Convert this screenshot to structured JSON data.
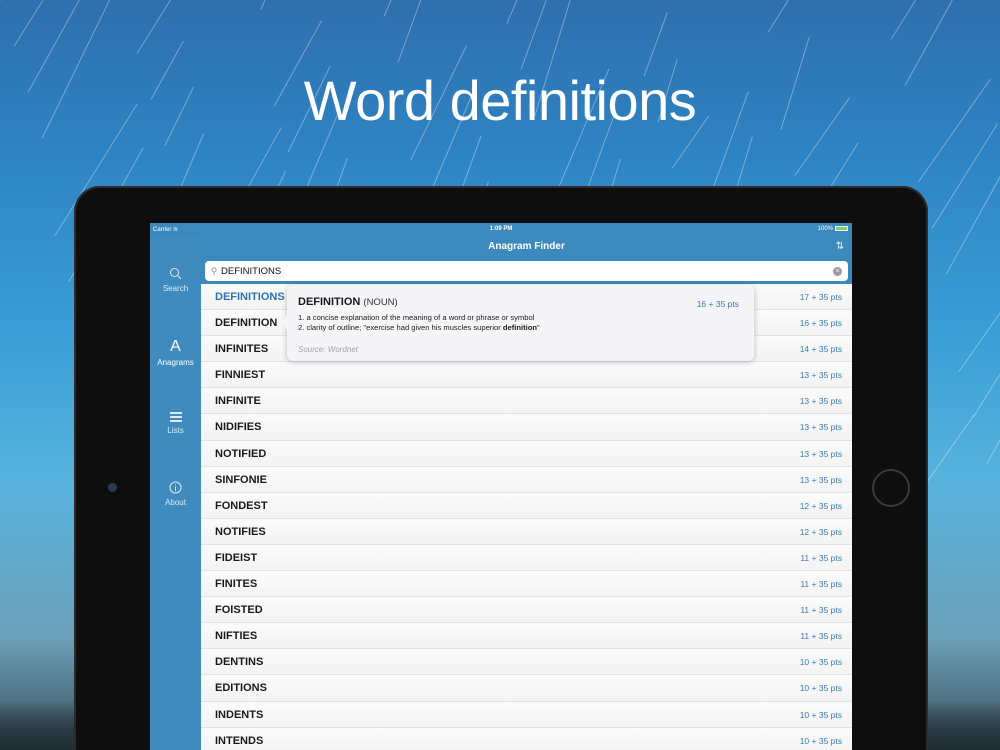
{
  "headline": "Word definitions",
  "status_bar": {
    "carrier": "Carrier",
    "time": "1:09 PM",
    "battery": "100%"
  },
  "nav": {
    "title": "Anagram Finder",
    "sort_icon": "sort-icon"
  },
  "search": {
    "value": "DEFINITIONS",
    "icon": "search-icon",
    "clear_icon": "clear-icon"
  },
  "sidebar": {
    "items": [
      {
        "label": "Search",
        "icon": "search-icon"
      },
      {
        "label": "Anagrams",
        "icon": "letter-a-icon"
      },
      {
        "label": "Lists",
        "icon": "list-icon"
      },
      {
        "label": "About",
        "icon": "info-icon"
      }
    ]
  },
  "results": [
    {
      "word": "DEFINITIONS",
      "points": "17 + 35 pts"
    },
    {
      "word": "DEFINITION",
      "points": "16 + 35 pts"
    },
    {
      "word": "INFINITES",
      "points": "14 + 35 pts"
    },
    {
      "word": "FINNIEST",
      "points": "13 + 35 pts"
    },
    {
      "word": "INFINITE",
      "points": "13 + 35 pts"
    },
    {
      "word": "NIDIFIES",
      "points": "13 + 35 pts"
    },
    {
      "word": "NOTIFIED",
      "points": "13 + 35 pts"
    },
    {
      "word": "SINFONIE",
      "points": "13 + 35 pts"
    },
    {
      "word": "FONDEST",
      "points": "12 + 35 pts"
    },
    {
      "word": "NOTIFIES",
      "points": "12 + 35 pts"
    },
    {
      "word": "FIDEIST",
      "points": "11 + 35 pts"
    },
    {
      "word": "FINITES",
      "points": "11 + 35 pts"
    },
    {
      "word": "FOISTED",
      "points": "11 + 35 pts"
    },
    {
      "word": "NIFTIES",
      "points": "11 + 35 pts"
    },
    {
      "word": "DENTINS",
      "points": "10 + 35 pts"
    },
    {
      "word": "EDITIONS",
      "points": "10 + 35 pts"
    },
    {
      "word": "INDENTS",
      "points": "10 + 35 pts"
    },
    {
      "word": "INTENDS",
      "points": "10 + 35 pts"
    }
  ],
  "definition_popover": {
    "word": "DEFINITION",
    "part_of_speech": "(NOUN)",
    "points": "16 + 35 pts",
    "definitions": [
      "1. a concise explanation of the meaning of a word or phrase or symbol",
      "2. clarity of outline; \"exercise had given his muscles superior "
    ],
    "definition2_bold": "definition",
    "definition2_end": "\"",
    "source": "Source: Wordnet"
  },
  "colors": {
    "bar_blue": "#3c89bd",
    "accent_blue": "#3c79b5"
  }
}
